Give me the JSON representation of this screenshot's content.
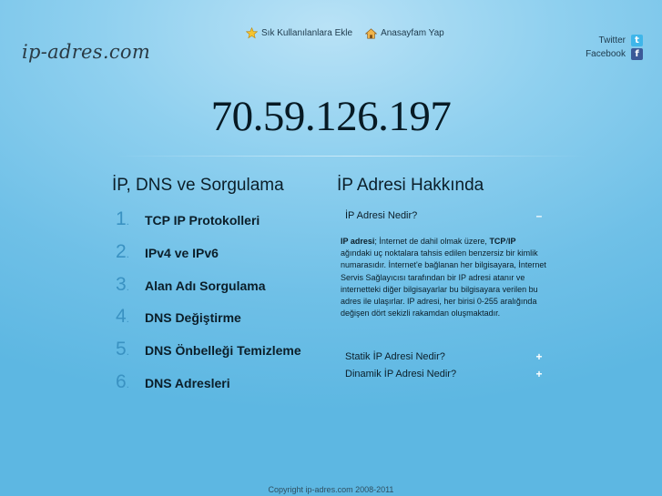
{
  "header": {
    "logo": "ip-adres.com",
    "bookmark_label": "Sık Kullanılanlara Ekle",
    "homepage_label": "Anasayfam Yap",
    "twitter_label": "Twitter",
    "facebook_label": "Facebook"
  },
  "ip_address": "70.59.126.197",
  "left": {
    "title": "İP, DNS ve Sorgulama",
    "items": [
      {
        "num": "1",
        "label": "TCP IP Protokolleri"
      },
      {
        "num": "2",
        "label": "IPv4 ve IPv6"
      },
      {
        "num": "3",
        "label": "Alan Adı Sorgulama"
      },
      {
        "num": "4",
        "label": "DNS Değiştirme"
      },
      {
        "num": "5",
        "label": "DNS Önbelleği Temizleme"
      },
      {
        "num": "6",
        "label": "DNS Adresleri"
      }
    ]
  },
  "right": {
    "title": "İP Adresi Hakkında",
    "accordion": [
      {
        "q": "İP Adresi Nedir?",
        "sign": "–"
      },
      {
        "q": "Statik İP Adresi Nedir?",
        "sign": "+"
      },
      {
        "q": "Dinamik İP Adresi Nedir?",
        "sign": "+"
      }
    ],
    "answer": {
      "bold1": "IP adresi",
      "part1": "; İnternet de dahil olmak üzere, ",
      "bold2": "TCP",
      "slash": "/",
      "bold3": "IP",
      "part2": " ağındaki uç noktalara tahsis edilen benzersiz bir kimlik numarasıdır. İnternet'e bağlanan her bilgisayara, İnternet Servis Sağlayıcısı tarafından bir IP adresi atanır ve internetteki diğer bilgisayarlar bu bilgisayara verilen bu adres ile ulaşırlar. IP adresi, her birisi 0-255 aralığında değişen dört sekizli rakamdan oluşmaktadır."
    }
  },
  "footer": {
    "copyright": "Copyright ip-adres.com 2008-2011"
  },
  "colors": {
    "background": "#63bae4",
    "number": "#3a92c2",
    "twitter": "#3fb6ea",
    "facebook": "#3b5998"
  },
  "icons": {
    "bookmark": "star-icon",
    "homepage": "home-icon",
    "twitter": "twitter-icon",
    "facebook": "facebook-icon"
  }
}
